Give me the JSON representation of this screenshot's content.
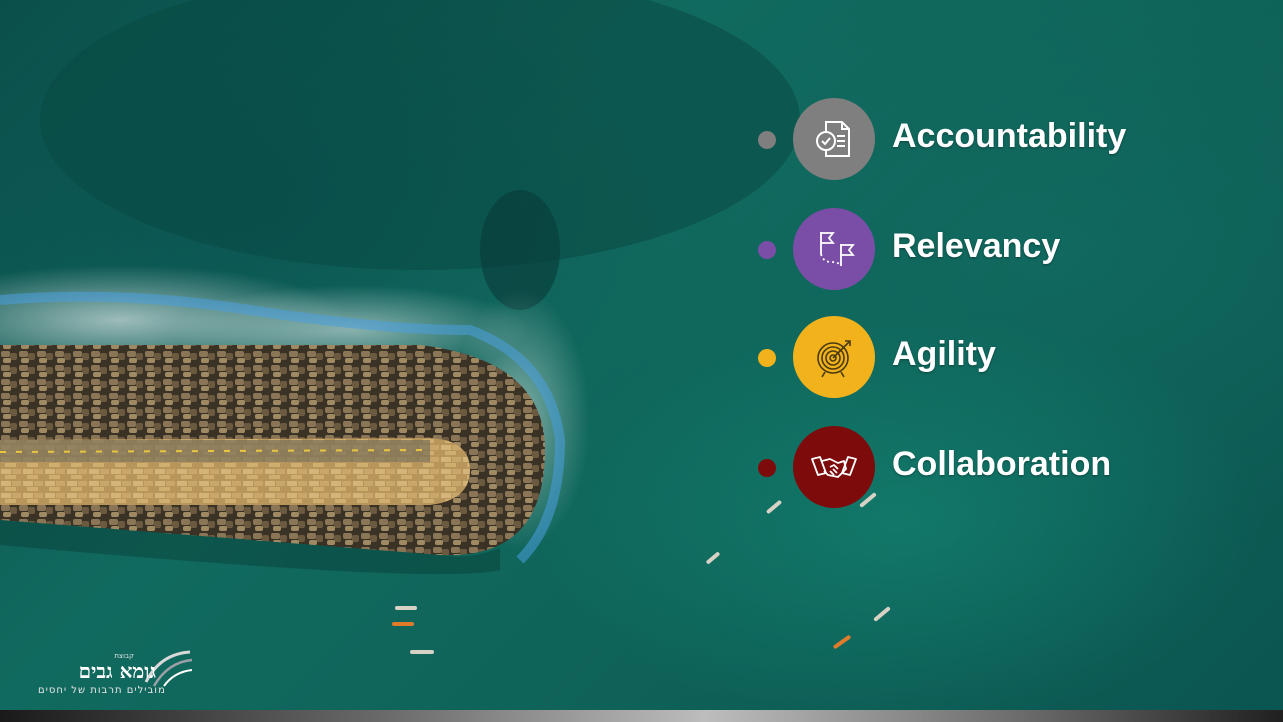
{
  "items": [
    {
      "label": "Accountability",
      "color": "#7f7f7f",
      "icon": "checklist-document-icon"
    },
    {
      "label": "Relevancy",
      "color": "#7a4ea6",
      "icon": "flags-route-icon"
    },
    {
      "label": "Agility",
      "color": "#f2b21c",
      "icon": "target-arrow-icon"
    },
    {
      "label": "Collaboration",
      "color": "#7d0b0b",
      "icon": "handshake-icon"
    }
  ],
  "logo": {
    "name": "גומא גבים",
    "prefix": "קבוצת",
    "tagline": "מובילים תרבות של יחסים"
  },
  "colors": {
    "sea": "#0f6459",
    "text": "#ffffff"
  }
}
